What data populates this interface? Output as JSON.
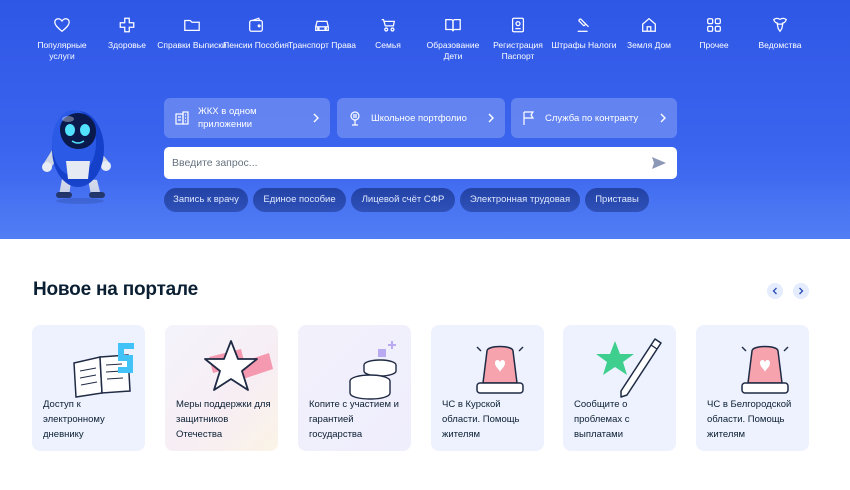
{
  "categories": [
    {
      "label": "Популярные услуги",
      "icon": "heart-icon"
    },
    {
      "label": "Здоровье",
      "icon": "medical-cross-icon"
    },
    {
      "label": "Справки Выписки",
      "icon": "folder-icon"
    },
    {
      "label": "Пенсии Пособия",
      "icon": "wallet-icon"
    },
    {
      "label": "Транспорт Права",
      "icon": "car-icon"
    },
    {
      "label": "Семья",
      "icon": "stroller-icon"
    },
    {
      "label": "Образование Дети",
      "icon": "book-icon"
    },
    {
      "label": "Регистрация Паспорт",
      "icon": "passport-icon"
    },
    {
      "label": "Штрафы Налоги",
      "icon": "gavel-icon"
    },
    {
      "label": "Земля Дом",
      "icon": "house-icon"
    },
    {
      "label": "Прочее",
      "icon": "grid-icon"
    },
    {
      "label": "Ведомства",
      "icon": "emblem-icon"
    }
  ],
  "quick_links": [
    {
      "label": "ЖКХ в одном приложении",
      "icon": "building-icon"
    },
    {
      "label": "Школьное портфолио",
      "icon": "microphone-icon"
    },
    {
      "label": "Служба по контракту",
      "icon": "flag-icon"
    }
  ],
  "search": {
    "placeholder": "Введите запрос..."
  },
  "tags": [
    "Запись к врачу",
    "Единое пособие",
    "Лицевой счёт СФР",
    "Электронная трудовая",
    "Приставы"
  ],
  "news": {
    "title": "Новое на портале",
    "cards": [
      {
        "text": "Доступ к электронному дневнику",
        "icon": "diary-icon"
      },
      {
        "text": "Меры поддержки для защитников Отечества",
        "icon": "star-icon"
      },
      {
        "text": "Копите с участием и гарантией государства",
        "icon": "coins-icon"
      },
      {
        "text": "ЧС в Курской области. Помощь жителям",
        "icon": "alarm-light-icon"
      },
      {
        "text": "Сообщите о проблемах с выплатами",
        "icon": "pen-icon"
      },
      {
        "text": "ЧС в Белгородской области. Помощь жителям",
        "icon": "alarm-light-icon"
      }
    ]
  },
  "colors": {
    "hero_blue": "#3a64ee",
    "tag_bg": "#1e3c9e",
    "card_bg": "#edf2fe",
    "text": "#0b1f33"
  }
}
